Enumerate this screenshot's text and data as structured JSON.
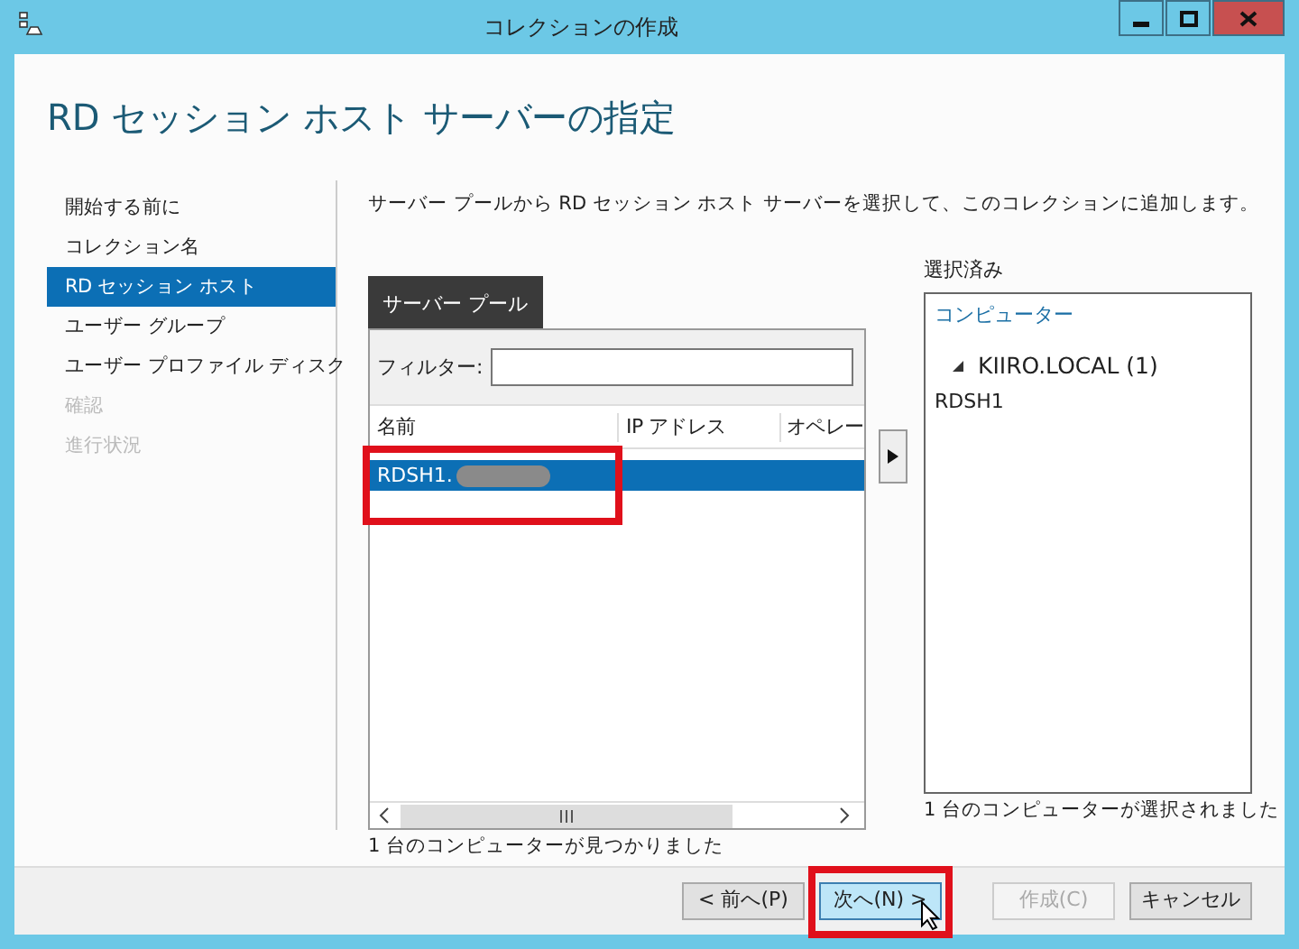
{
  "window": {
    "title": "コレクションの作成"
  },
  "heading": "RD セッション ホスト サーバーの指定",
  "steps": [
    {
      "label": "開始する前に",
      "selected": false,
      "disabled": false
    },
    {
      "label": "コレクション名",
      "selected": false,
      "disabled": false
    },
    {
      "label": "RD セッション ホスト",
      "selected": true,
      "disabled": false
    },
    {
      "label": "ユーザー グループ",
      "selected": false,
      "disabled": false
    },
    {
      "label": "ユーザー プロファイル ディスク",
      "selected": false,
      "disabled": false
    },
    {
      "label": "確認",
      "selected": false,
      "disabled": true
    },
    {
      "label": "進行状況",
      "selected": false,
      "disabled": true
    }
  ],
  "description": "サーバー プールから RD セッション ホスト サーバーを選択して、このコレクションに追加します。",
  "server_pool": {
    "tab": "サーバー プール",
    "filter_label": "フィルター:",
    "columns": [
      "名前",
      "IP アドレス",
      "オペレー"
    ],
    "rows": [
      {
        "name": "RDSH1.",
        "selected": true,
        "highlighted": true
      }
    ],
    "status": "1 台のコンピューターが見つかりました"
  },
  "selected_list": {
    "label": "選択済み",
    "column": "コンピューター",
    "tree": [
      {
        "label": "KIIRO.LOCAL (1)",
        "expanded": true,
        "children": [
          {
            "label": "RDSH1"
          }
        ]
      }
    ],
    "status": "1 台のコンピューターが選択されました"
  },
  "buttons": [
    {
      "label": "< 前へ(P)",
      "kind": "normal",
      "highlighted": false
    },
    {
      "label": "次へ(N) >",
      "kind": "hover",
      "highlighted": true
    },
    {
      "label": "作成(C)",
      "kind": "disabled",
      "highlighted": false
    },
    {
      "label": "キャンセル",
      "kind": "normal",
      "highlighted": false
    }
  ]
}
